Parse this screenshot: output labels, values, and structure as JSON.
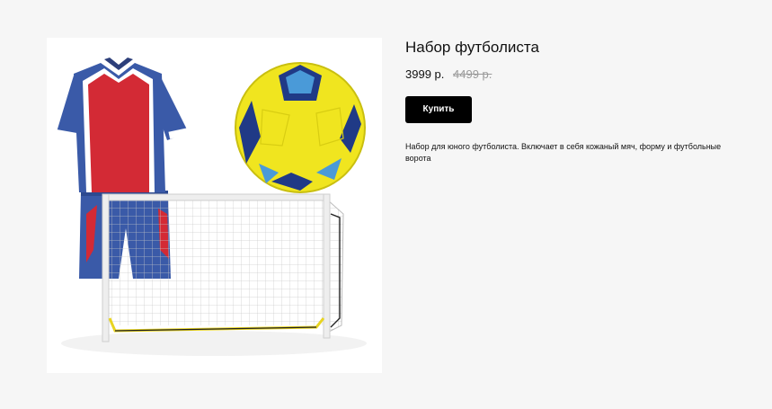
{
  "product": {
    "title": "Набор футболиста",
    "price": "3999 р.",
    "old_price": "4499 р.",
    "buy_label": "Купить",
    "description": "Набор для юного футболиста. Включает в себя кожаный мяч, форму и футбольные ворота"
  },
  "colors": {
    "background": "#f6f6f6",
    "button": "#000000",
    "button_text": "#ffffff",
    "old_price": "#9a9a9a"
  }
}
